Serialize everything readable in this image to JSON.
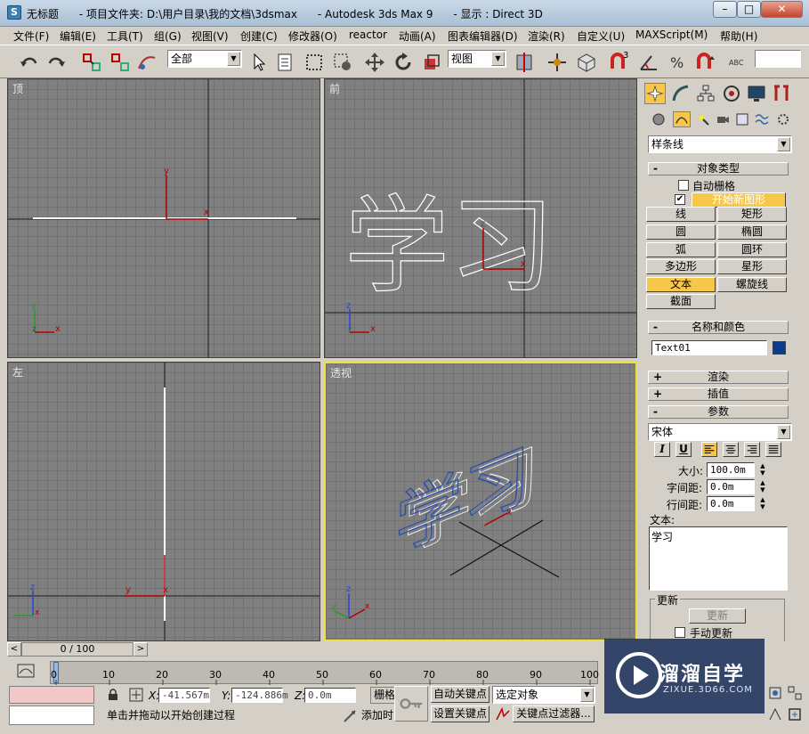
{
  "title": {
    "app_name": "无标题",
    "project_folder": "- 项目文件夹: D:\\用户目录\\我的文档\\3dsmax",
    "product": "- Autodesk 3ds Max 9",
    "display": "- 显示 : Direct 3D"
  },
  "window_controls": {
    "minimize": "–",
    "maximize": "□",
    "close": "✕"
  },
  "menu": [
    "文件(F)",
    "编辑(E)",
    "工具(T)",
    "组(G)",
    "视图(V)",
    "创建(C)",
    "修改器(O)",
    "reactor",
    "动画(A)",
    "图表编辑器(D)",
    "渲染(R)",
    "自定义(U)",
    "MAXScript(M)",
    "帮助(H)"
  ],
  "toolbar": {
    "selection_filter": "全部",
    "reference_coord": "视图",
    "snap_count": "3"
  },
  "viewports": {
    "top": {
      "label": "顶"
    },
    "front": {
      "label": "前"
    },
    "left": {
      "label": "左"
    },
    "perspective": {
      "label": "透视"
    }
  },
  "axis_labels": {
    "x": "x",
    "y": "y",
    "z": "z"
  },
  "command_panel": {
    "category": "样条线",
    "object_type": {
      "header": "对象类型",
      "auto_grid": "自动栅格",
      "start_new_shape": "开始新图形",
      "auto_grid_checked": false,
      "start_new_shape_checked": true,
      "buttons": [
        "线",
        "矩形",
        "圆",
        "椭圆",
        "弧",
        "圆环",
        "多边形",
        "星形",
        "文本",
        "螺旋线",
        "截面"
      ],
      "active": "文本"
    },
    "name_color": {
      "header": "名称和颜色",
      "name": "Text01",
      "color": "#0a3b8f"
    },
    "render_header": "渲染",
    "interp_header": "插值",
    "params": {
      "header": "参数",
      "font": "宋体",
      "italic": "I",
      "underline": "U",
      "size_label": "大小:",
      "size_value": "100.0m",
      "kerning_label": "字间距:",
      "kerning_value": "0.0m",
      "leading_label": "行间距:",
      "leading_value": "0.0m",
      "text_label": "文本:",
      "text_value": "学习"
    },
    "update": {
      "header": "更新",
      "button": "更新",
      "manual_label": "手动更新"
    }
  },
  "timeline": {
    "frame": "0 / 100",
    "ticks": [
      "0",
      "10",
      "20",
      "30",
      "40",
      "50",
      "60",
      "70",
      "80",
      "90",
      "100"
    ],
    "prev": "<",
    "next": ">"
  },
  "status": {
    "x_label": "X:",
    "x_value": "-41.567m",
    "y_label": "Y:",
    "y_value": "-124.886m",
    "z_label": "Z:",
    "z_value": "0.0m",
    "grid": "栅格",
    "auto_key": "自动关键点",
    "selected_object": "选定对象",
    "set_key": "设置关键点",
    "key_filter": "关键点过滤器...",
    "prompt": "单击并拖动以开始创建过程",
    "add": "添加时"
  },
  "watermark": {
    "brand": "溜溜自学",
    "url": "ZIXUE.3D66.COM"
  }
}
